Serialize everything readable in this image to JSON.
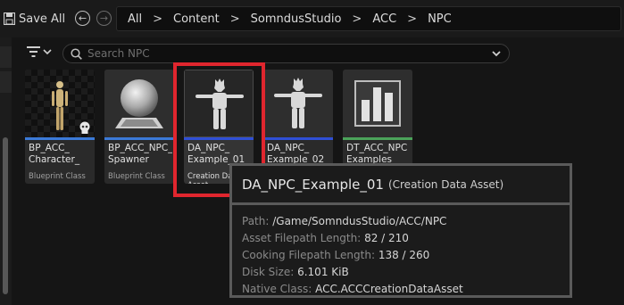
{
  "toolbar": {
    "save_all_label": "Save All"
  },
  "breadcrumb": {
    "items": [
      "All",
      "Content",
      "SomndusStudio",
      "ACC",
      "NPC"
    ]
  },
  "search": {
    "placeholder": "Search NPC"
  },
  "assets": [
    {
      "name": "BP_ACC_\nCharacter_\nNPC",
      "type": "Blueprint Class",
      "bar_color": "#3b7ad8",
      "thumb": "character"
    },
    {
      "name": "BP_ACC_NPC_\nSpawner",
      "type": "Blueprint Class",
      "bar_color": "#3b7ad8",
      "thumb": "sphere"
    },
    {
      "name": "DA_NPC_\nExample_01",
      "type": "Creation Data Asset",
      "bar_color": "#2f4fd6",
      "thumb": "mannequin",
      "selected": true
    },
    {
      "name": "DA_NPC_\nExample_02",
      "type": "",
      "bar_color": "#2f4fd6",
      "thumb": "mannequin"
    },
    {
      "name": "DT_ACC_NPC\nExamples",
      "type": "",
      "bar_color": "#4ba35a",
      "thumb": "datatable"
    }
  ],
  "tooltip": {
    "name": "DA_NPC_Example_01",
    "kind": "(Creation Data Asset)",
    "rows": [
      {
        "key": "Path:",
        "value": "/Game/SomndusStudio/ACC/NPC"
      },
      {
        "key": "Asset Filepath Length:",
        "value": "82 / 210"
      },
      {
        "key": "Cooking Filepath Length:",
        "value": "138 / 260"
      },
      {
        "key": "Disk Size:",
        "value": "6.101 KiB"
      },
      {
        "key": "Native Class:",
        "value": "ACC.ACCCreationDataAsset"
      }
    ]
  },
  "colors": {
    "highlight": "#e0262e",
    "blueprint_bar": "#3b7ad8",
    "data_asset_bar": "#2f4fd6",
    "data_table_bar": "#4ba35a"
  }
}
